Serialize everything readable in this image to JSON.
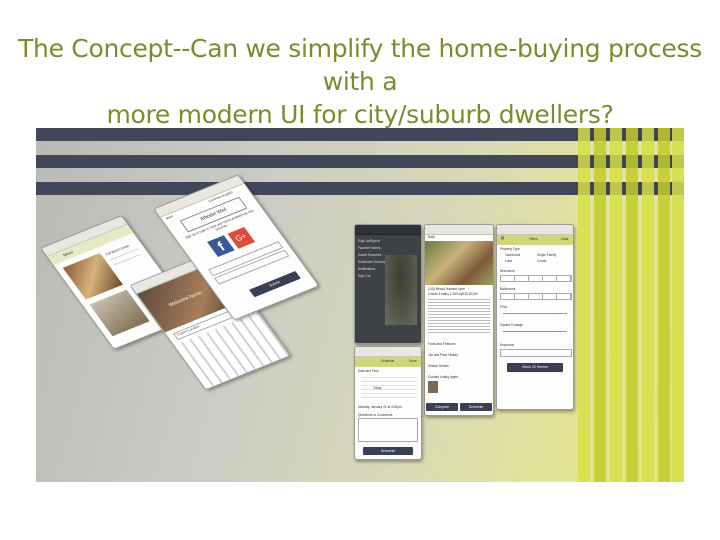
{
  "title": {
    "line1": "The Concept--Can we simplify the home-buying process with a",
    "line2": "more modern UI for city/suburb dwellers?"
  },
  "colors": {
    "title": "#7b8c2c",
    "stripe": "#414659",
    "accent": "#d6df48",
    "button": "#3a3f53"
  },
  "screens": {
    "menu": {
      "label": "Menu",
      "address": "216 Beach Street"
    },
    "signin": {
      "brand": "Albodel Weil",
      "back": "Back",
      "continue": "Continue as guest",
      "pitch": "Sign up or login to save your home preferences and favorites.",
      "submit": "Submit"
    },
    "welcome": {
      "heading": "Welcome home.",
      "current_location": "Current Location"
    },
    "nav": {
      "items": [
        "Sign Up/Sign In",
        "Favorite Homes",
        "Saved Searches",
        "Scheduled Showings",
        "Notifications",
        "Sign Out"
      ]
    },
    "listing": {
      "back": "Back",
      "address": "1424 Beach Harvest Lane",
      "specs": "4 beds   3 baths   2,250 sqft   $215,000",
      "sections": [
        "Facts and Features",
        "Tax and Price History",
        "Similar Homes",
        "Contact Listing Agent"
      ],
      "compare": "Compare",
      "schedule": "Schedule"
    },
    "schedule_screen": {
      "title": "Schedule",
      "done": "Done",
      "date_time": "Date and Time",
      "today": "Today",
      "selected": "Monday, January 21 at 4:00pm",
      "questions": "Questions or Comments",
      "button": "Schedule"
    },
    "filters": {
      "title": "Filters",
      "clear": "Clear",
      "property_type": "Property Type",
      "types": [
        "Townhome",
        "Single Family",
        "Land",
        "Condo"
      ],
      "bedrooms": "Bedrooms",
      "bathrooms": "Bathrooms",
      "price": "Price",
      "square_footage": "Square Footage",
      "keywords": "Keywords",
      "show": "Show 20 Homes"
    }
  }
}
